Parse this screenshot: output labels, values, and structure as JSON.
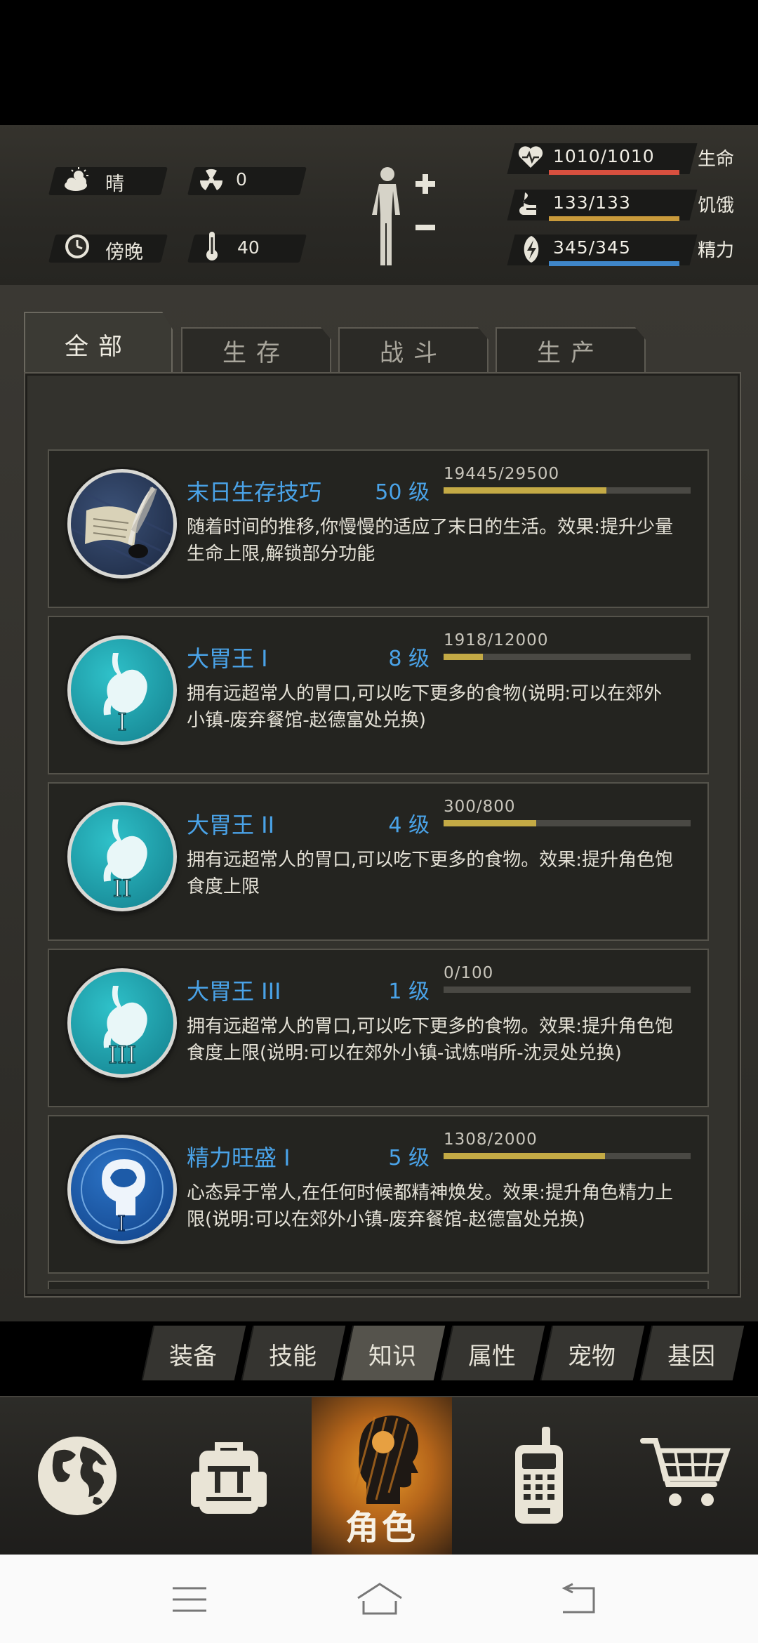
{
  "status": {
    "weather": {
      "icon": "sun-cloud-icon",
      "label": "晴"
    },
    "radiation": {
      "icon": "radiation-icon",
      "value": "0"
    },
    "time_of_day": {
      "icon": "clock-icon",
      "label": "傍晚"
    },
    "temperature": {
      "icon": "thermometer-icon",
      "value": "40"
    },
    "body_icon": "body-figure-icon",
    "health": {
      "text": "1010/1010",
      "label": "生命",
      "ratio": 1.0,
      "color": "#d9503f"
    },
    "hunger": {
      "text": "133/133",
      "label": "饥饿",
      "ratio": 1.0,
      "color": "#c99a3b"
    },
    "energy": {
      "text": "345/345",
      "label": "精力",
      "ratio": 1.0,
      "color": "#3f86c9"
    }
  },
  "tabs": [
    {
      "label": "全部",
      "active": true
    },
    {
      "label": "生存",
      "active": false
    },
    {
      "label": "战斗",
      "active": false
    },
    {
      "label": "生产",
      "active": false
    }
  ],
  "skills": [
    {
      "name": "末日生存技巧",
      "level": "50 级",
      "xp": "19445/29500",
      "progress": 0.659,
      "icon": "scroll-quill-icon",
      "desc": "随着时间的推移,你慢慢的适应了末日的生活。效果:提升少量生命上限,解锁部分功能"
    },
    {
      "name": "大胃王 I",
      "level": "8 级",
      "xp": "1918/12000",
      "progress": 0.16,
      "icon": "stomach-icon",
      "desc": "拥有远超常人的胃口,可以吃下更多的食物(说明:可以在郊外小镇-废弃餐馆-赵德富处兑换)"
    },
    {
      "name": "大胃王 II",
      "level": "4 级",
      "xp": "300/800",
      "progress": 0.375,
      "icon": "stomach-icon",
      "desc": "拥有远超常人的胃口,可以吃下更多的食物。效果:提升角色饱食度上限"
    },
    {
      "name": "大胃王 III",
      "level": "1 级",
      "xp": "0/100",
      "progress": 0.0,
      "icon": "stomach-icon",
      "desc": "拥有远超常人的胃口,可以吃下更多的食物。效果:提升角色饱食度上限(说明:可以在郊外小镇-试炼哨所-沈灵处兑换)"
    },
    {
      "name": "精力旺盛 I",
      "level": "5 级",
      "xp": "1308/2000",
      "progress": 0.654,
      "icon": "brain-head-icon",
      "desc": "心态异于常人,在任何时候都精神焕发。效果:提升角色精力上限(说明:可以在郊外小镇-废弃餐馆-赵德富处兑换)"
    }
  ],
  "subtabs": [
    {
      "label": "装备",
      "active": false
    },
    {
      "label": "技能",
      "active": false
    },
    {
      "label": "知识",
      "active": true
    },
    {
      "label": "属性",
      "active": false
    },
    {
      "label": "宠物",
      "active": false
    },
    {
      "label": "基因",
      "active": false
    }
  ],
  "nav": {
    "role_label": "角色",
    "items": [
      "globe-icon",
      "backpack-icon",
      "role-head-icon",
      "radio-icon",
      "cart-icon"
    ]
  },
  "system_nav": [
    "menu-icon",
    "home-icon",
    "back-icon"
  ]
}
